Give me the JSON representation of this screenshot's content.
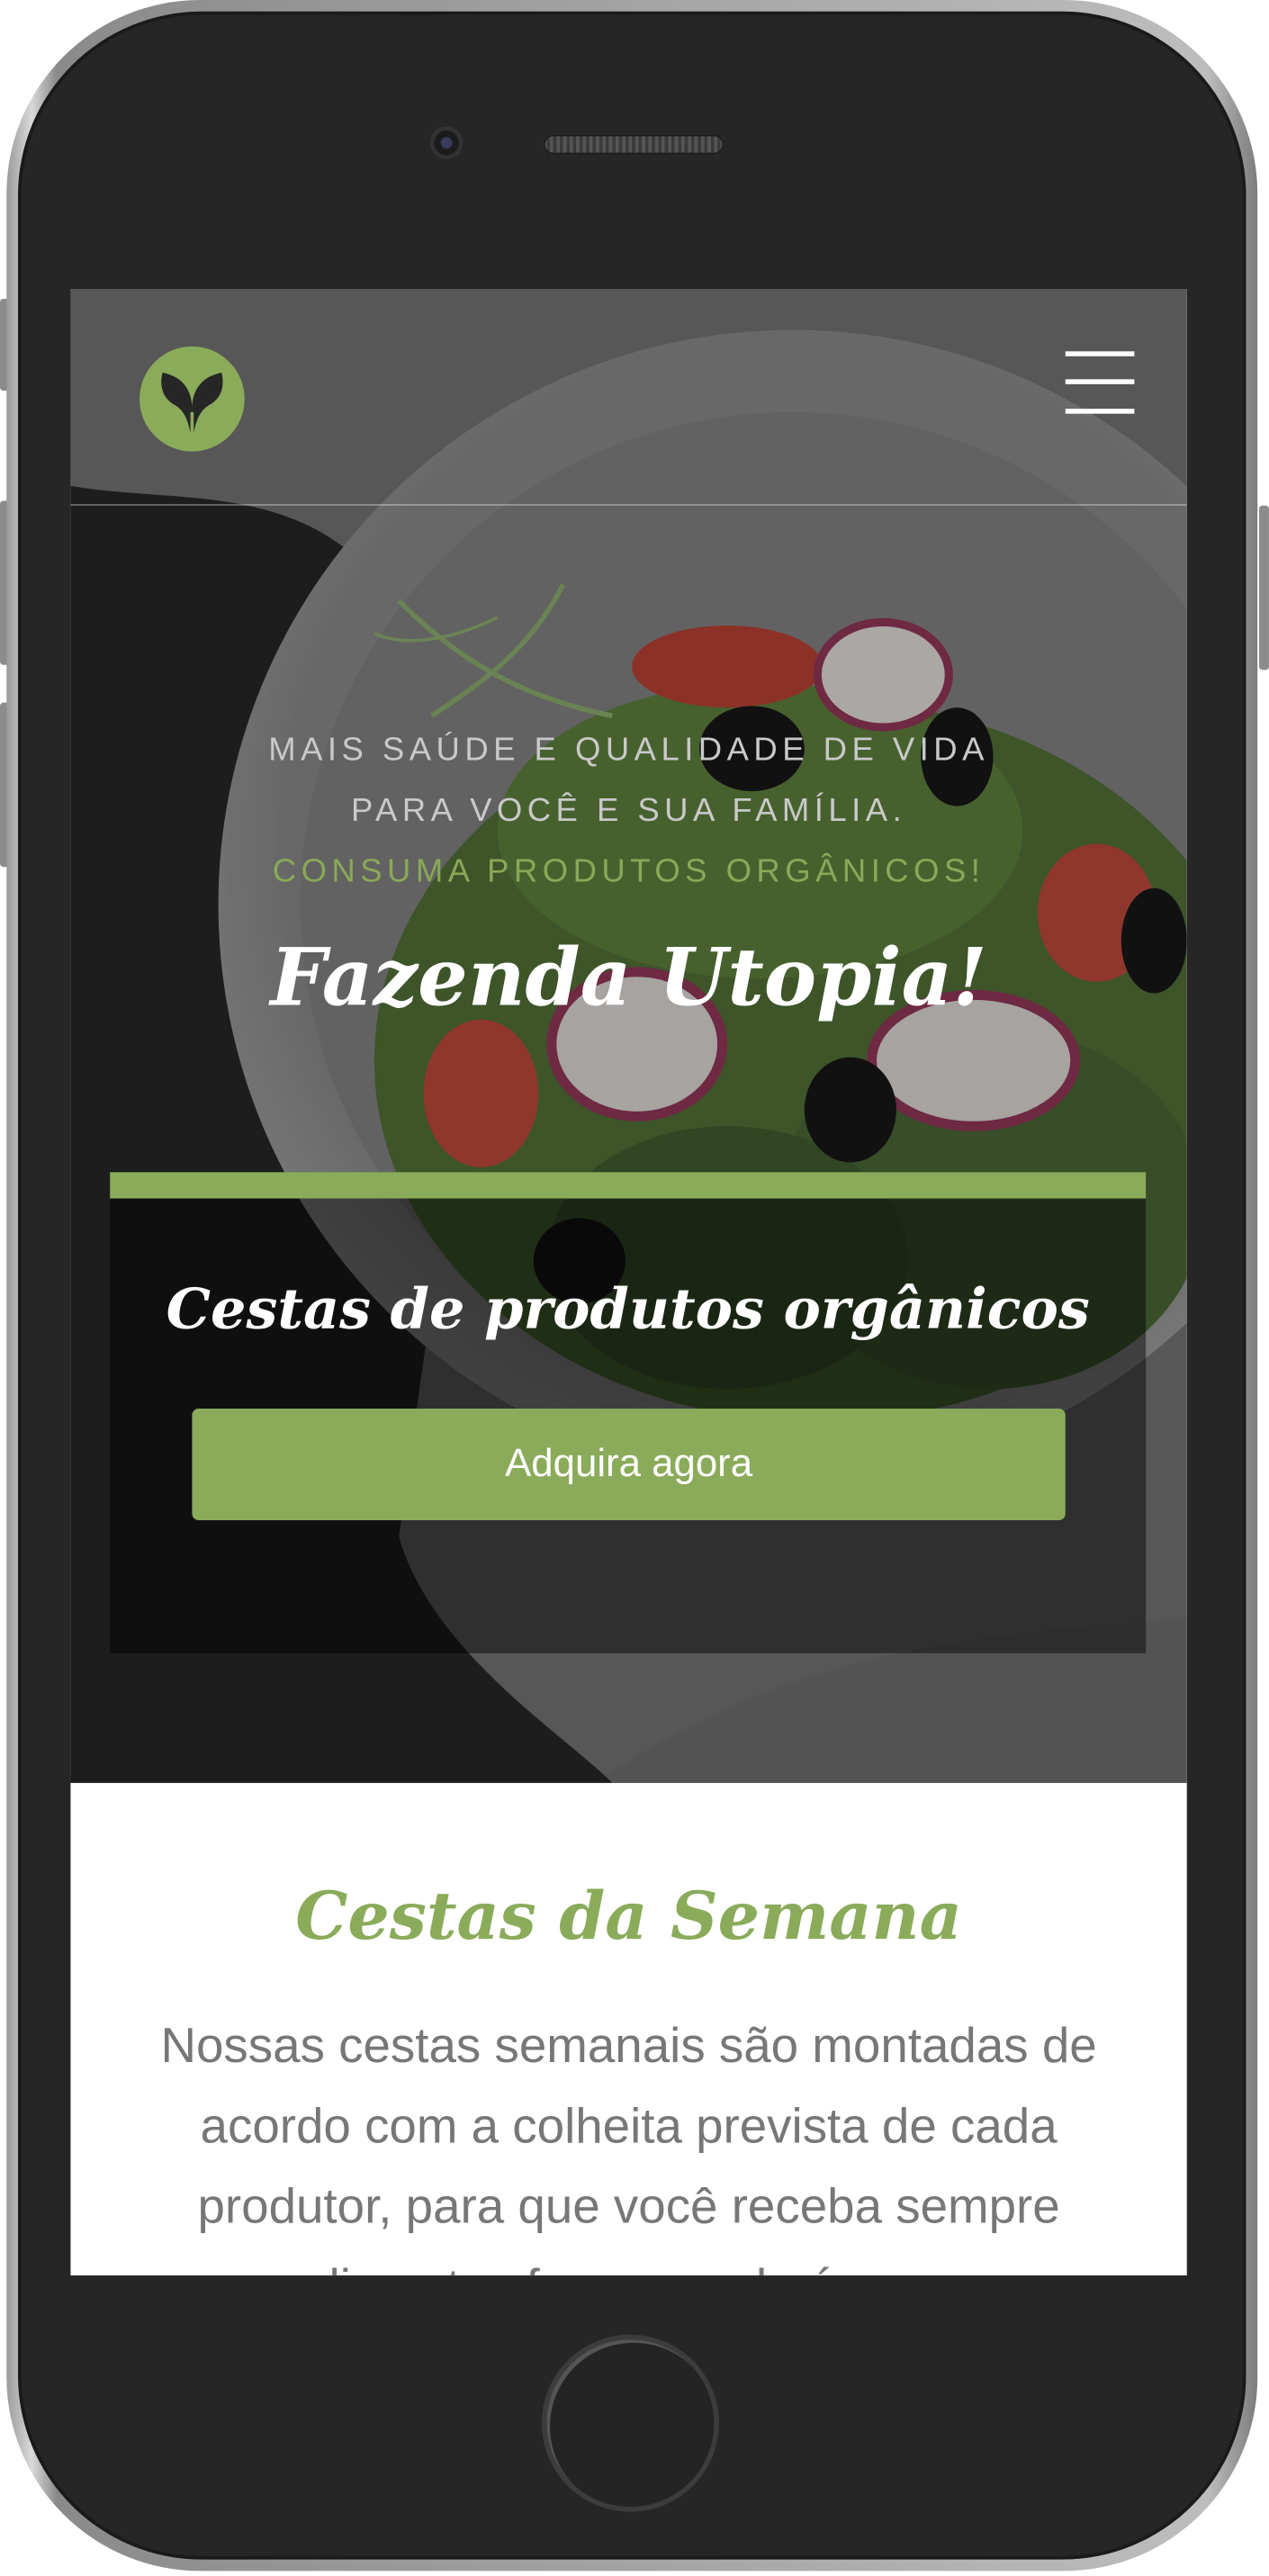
{
  "hero": {
    "tagline_line1": "MAIS SAÚDE E QUALIDADE DE VIDA",
    "tagline_line2": "PARA VOCÊ E SUA FAMÍLIA.",
    "tagline_line3": "CONSUMA PRODUTOS ORGÂNICOS!",
    "title": "Fazenda Utopia!",
    "card_title": "Cestas de produtos orgânicos",
    "cta_label": "Adquira agora"
  },
  "section": {
    "title": "Cestas da Semana",
    "text": "Nossas cestas semanais são montadas de acordo com a colheita prevista de cada produtor, para que você receba sempre alimentos frescos e de época."
  },
  "colors": {
    "accent": "#8aab5a",
    "dark": "#262626",
    "text_gray": "#777777"
  },
  "icons": {
    "logo": "leaf-logo-icon",
    "menu": "hamburger-menu-icon"
  }
}
